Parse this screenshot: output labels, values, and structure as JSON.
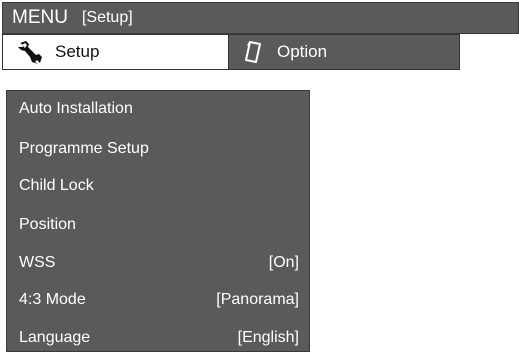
{
  "header": {
    "menu_label": "MENU",
    "sub_label": "[Setup]"
  },
  "tabs": [
    {
      "label": "Setup",
      "icon": "wrench-icon",
      "selected": true
    },
    {
      "label": "Option",
      "icon": "card-icon",
      "selected": false
    }
  ],
  "menu": {
    "items": [
      {
        "label": "Auto Installation",
        "value": ""
      },
      {
        "label": "Programme Setup",
        "value": ""
      },
      {
        "label": "Child Lock",
        "value": ""
      },
      {
        "label": "Position",
        "value": ""
      },
      {
        "label": "WSS",
        "value": "[On]"
      },
      {
        "label": "4:3 Mode",
        "value": "[Panorama]"
      },
      {
        "label": "Language",
        "value": "[English]"
      }
    ]
  },
  "colors": {
    "panel_bg": "#5a5a5a",
    "selected_tab_bg": "#ffffff",
    "text_light": "#ffffff",
    "text_dark": "#111111"
  }
}
